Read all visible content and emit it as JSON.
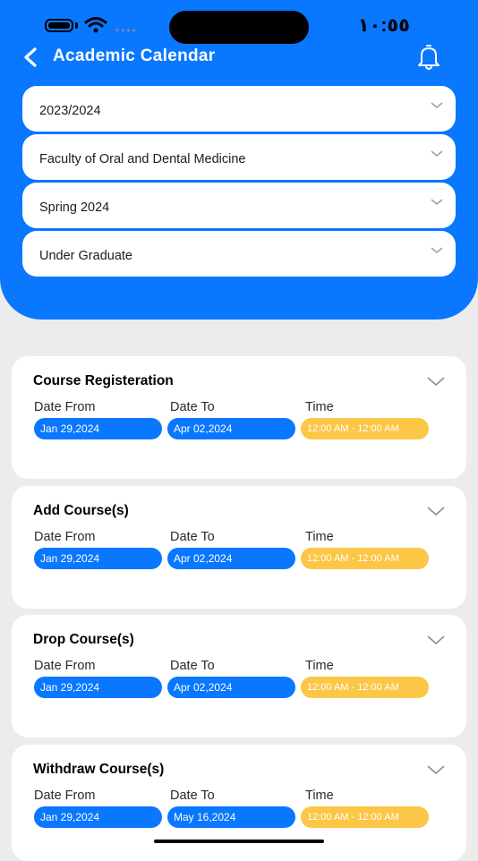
{
  "status": {
    "time": "١٠:٥٥"
  },
  "header": {
    "title": "Academic Calendar"
  },
  "filters": [
    {
      "value": "2023/2024"
    },
    {
      "value": "Faculty of Oral and Dental Medicine"
    },
    {
      "value": "Spring 2024"
    },
    {
      "value": "Under Graduate"
    }
  ],
  "labels": {
    "date_from": "Date From",
    "date_to": "Date To",
    "time": "Time"
  },
  "events": [
    {
      "title": "Course Registeration",
      "from": "Jan 29,2024",
      "to": "Apr 02,2024",
      "time": "12:00 AM - 12:00 AM"
    },
    {
      "title": "Add Course(s)",
      "from": "Jan 29,2024",
      "to": "Apr 02,2024",
      "time": "12:00 AM - 12:00 AM"
    },
    {
      "title": "Drop Course(s)",
      "from": "Jan 29,2024",
      "to": "Apr 02,2024",
      "time": "12:00 AM - 12:00 AM"
    },
    {
      "title": "Withdraw Course(s)",
      "from": "Jan 29,2024",
      "to": "May 16,2024",
      "time": "12:00 AM - 12:00 AM"
    }
  ],
  "colors": {
    "primary": "#0a77ff",
    "time_pill": "#fcc646",
    "background": "#ececec"
  }
}
